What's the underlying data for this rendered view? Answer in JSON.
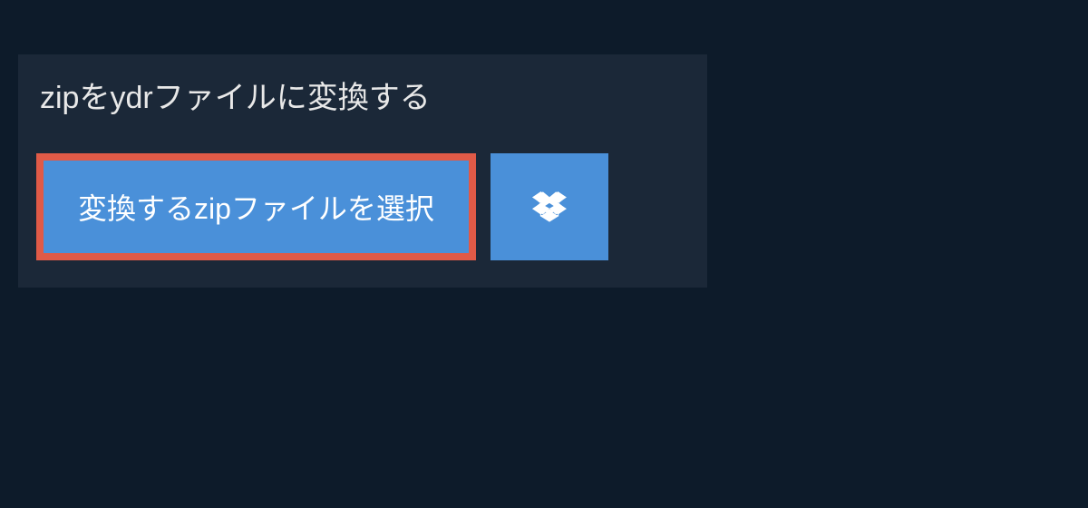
{
  "heading": "zipをydrファイルに変換する",
  "buttons": {
    "select_label": "変換するzipファイルを選択"
  },
  "colors": {
    "page_bg": "#0d1b2a",
    "panel_bg": "#1b2838",
    "button_bg": "#4a90d9",
    "highlight_border": "#e05a47",
    "text": "#e8e8e8"
  }
}
